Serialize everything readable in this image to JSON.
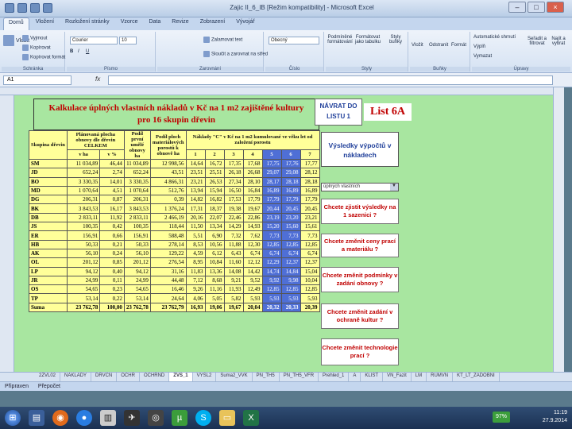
{
  "window": {
    "title": "Zajic II_6_IB [Režim kompatibility] - Microsoft Excel",
    "controls": [
      "–",
      "□",
      "×"
    ]
  },
  "menu_tabs": [
    "Domů",
    "Vložení",
    "Rozložení stránky",
    "Vzorce",
    "Data",
    "Revize",
    "Zobrazení",
    "Vývojář"
  ],
  "ribbon": {
    "clipboard": {
      "paste": "Vložit",
      "cut": "Vyjmout",
      "copy": "Kopírovat",
      "format_painter": "Kopírovat formát",
      "group": "Schránka"
    },
    "font": {
      "name": "Courier",
      "size": "10",
      "group": "Písmo"
    },
    "alignment": {
      "wrap": "Zalamovat text",
      "merge": "Sloučit a zarovnat na střed",
      "group": "Zarovnání"
    },
    "number": {
      "format": "Obecný",
      "group": "Číslo"
    },
    "styles": {
      "conditional": "Podmíněné formátování",
      "table": "Formátovat jako tabulku",
      "cell": "Styly buňky",
      "group": "Styly"
    },
    "cells": {
      "insert": "Vložit",
      "delete": "Odstranit",
      "format": "Formát",
      "group": "Buňky"
    },
    "editing": {
      "autosum": "Automatické shrnutí",
      "fill": "Výplň",
      "clear": "Vymazat",
      "sort": "Seřadit a filtrovat",
      "find": "Najít a vybrat",
      "group": "Úpravy"
    }
  },
  "formula_bar": {
    "name_box": "A1",
    "fx": "fx",
    "value": ""
  },
  "heading": {
    "line1": "Kalkulace úplných vlastních nákladů v Kč na 1 m2 zajištěné kultury",
    "line2": "pro 16 skupin dřevin"
  },
  "nav_button": {
    "line1": "NÁVRAT DO",
    "line2": "LISTU 1"
  },
  "list_label": "List 6A",
  "table": {
    "headers": {
      "species": "Skupina dřevin",
      "area": "Plánovaná plocha obnovy dle dřevin CELKEM",
      "share": "Podíl první umělé obnovy ha",
      "material": "Podíl ploch materiálových porostů k obnově ha",
      "costs": "Náklady \"C\" v Kč na 1 m2 kumulované ve věku let od založení porostu",
      "unit_ha": "v ha",
      "unit_pct": "v %",
      "years": [
        "1",
        "2",
        "3",
        "4",
        "5",
        "6",
        "7"
      ]
    },
    "rows": [
      [
        "SM",
        "11 034,89",
        "46,44",
        "11 034,89",
        "12 998,56",
        "14,64",
        "16,72",
        "17,35",
        "17,68",
        "17,75",
        "17,76",
        "17,77"
      ],
      [
        "JD",
        "652,24",
        "2,74",
        "652,24",
        "43,51",
        "23,51",
        "25,51",
        "26,18",
        "26,68",
        "29,07",
        "29,08",
        "28,12"
      ],
      [
        "BO",
        "3 330,35",
        "14,01",
        "3 330,35",
        "4 866,31",
        "23,21",
        "26,53",
        "27,34",
        "28,10",
        "28,17",
        "28,18",
        "28,18"
      ],
      [
        "MD",
        "1 070,64",
        "4,51",
        "1 070,64",
        "512,76",
        "13,94",
        "15,94",
        "16,50",
        "16,84",
        "16,89",
        "16,89",
        "16,89"
      ],
      [
        "DG",
        "206,31",
        "0,87",
        "206,31",
        "0,39",
        "14,82",
        "16,82",
        "17,53",
        "17,79",
        "17,79",
        "17,79",
        "17,79"
      ],
      [
        "BK",
        "3 843,53",
        "16,17",
        "3 843,53",
        "1 376,24",
        "17,31",
        "18,37",
        "19,38",
        "19,67",
        "20,44",
        "20,45",
        "20,45"
      ],
      [
        "DB",
        "2 833,11",
        "11,92",
        "2 833,11",
        "2 466,19",
        "20,16",
        "22,07",
        "22,46",
        "22,86",
        "23,19",
        "23,20",
        "23,21"
      ],
      [
        "JS",
        "100,35",
        "0,42",
        "100,35",
        "118,44",
        "11,50",
        "13,34",
        "14,29",
        "14,93",
        "15,20",
        "15,60",
        "15,61"
      ],
      [
        "ER",
        "156,91",
        "0,66",
        "156,91",
        "588,48",
        "5,51",
        "6,90",
        "7,32",
        "7,62",
        "7,73",
        "7,73",
        "7,73"
      ],
      [
        "HB",
        "50,33",
        "0,21",
        "50,33",
        "278,14",
        "8,53",
        "10,56",
        "11,88",
        "12,30",
        "12,85",
        "12,85",
        "12,85"
      ],
      [
        "AK",
        "56,10",
        "0,24",
        "56,10",
        "129,22",
        "4,59",
        "6,12",
        "6,43",
        "6,74",
        "6,74",
        "6,74",
        "6,74"
      ],
      [
        "OL",
        "201,12",
        "0,85",
        "201,12",
        "276,54",
        "8,95",
        "10,84",
        "11,60",
        "12,12",
        "12,29",
        "12,37",
        "12,37"
      ],
      [
        "LP",
        "94,12",
        "0,40",
        "94,12",
        "31,16",
        "11,83",
        "13,36",
        "14,08",
        "14,42",
        "14,74",
        "14,84",
        "15,04"
      ],
      [
        "JR",
        "24,99",
        "0,11",
        "24,99",
        "44,48",
        "7,12",
        "8,68",
        "9,21",
        "9,52",
        "9,92",
        "9,98",
        "10,04"
      ],
      [
        "OS",
        "54,65",
        "0,23",
        "54,65",
        "16,46",
        "9,26",
        "11,16",
        "11,93",
        "12,49",
        "12,85",
        "12,85",
        "12,85"
      ],
      [
        "TP",
        "53,14",
        "0,22",
        "53,14",
        "24,64",
        "4,06",
        "5,05",
        "5,82",
        "5,93",
        "5,93",
        "5,93",
        "5,93"
      ]
    ],
    "sum": [
      "Suma",
      "23 762,78",
      "100,00",
      "23 762,78",
      "23 762,79",
      "16,93",
      "19,06",
      "19,67",
      "20,04",
      "20,32",
      "20,33",
      "20,39"
    ]
  },
  "right_panel": {
    "results_title": "Výsledky výpočtů v nákladech",
    "dropdown": "úplných vlastních",
    "q1": "Chcete zjistit výsledky na 1 sazenici ?",
    "q2": "Chcete změnit ceny prací a materiálu ?",
    "q3": "Chcete změnit podmínky v zadání obnovy ?",
    "q4": "Chcete změnit zadání v ochraně kultur ?",
    "q5": "Chcete změnit technologie prací ?"
  },
  "sheet_tabs": [
    "2ZVL02",
    "NÁKLADY",
    "DRVCN",
    "OCHR",
    "OCHRND",
    "ZVS_1",
    "VYSL2",
    "Suma2_VVK",
    "PN_TH5",
    "PN_TH5_VFR",
    "Prehled_1",
    "A",
    "KLIST",
    "VN_Fazit",
    "LM",
    "RUMVN",
    "KT_LT_ZADOBNI"
  ],
  "active_sheet": "ZVS_1",
  "status": {
    "left": "Připraven",
    "mid": "Přepočet"
  },
  "taskbar": {
    "time": "11:19",
    "date": "27.9.2014",
    "battery": "97%"
  }
}
